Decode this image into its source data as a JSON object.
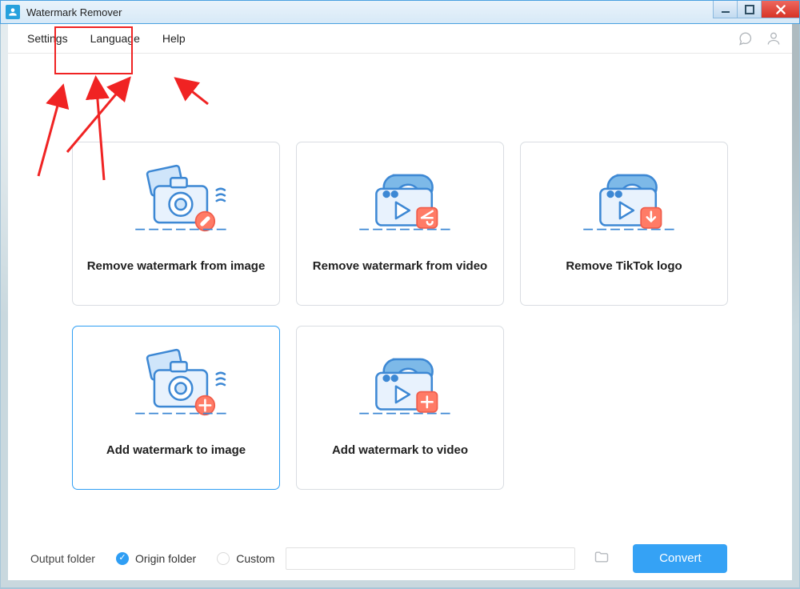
{
  "window": {
    "title": "Watermark Remover"
  },
  "menu": {
    "items": [
      "Settings",
      "Language",
      "Help"
    ]
  },
  "cards": [
    {
      "caption": "Remove watermark from image"
    },
    {
      "caption": "Remove watermark from video"
    },
    {
      "caption": "Remove TikTok logo"
    },
    {
      "caption": "Add watermark to image"
    },
    {
      "caption": "Add watermark to video"
    }
  ],
  "bottom": {
    "outputLabel": "Output folder",
    "originLabel": "Origin folder",
    "customLabel": "Custom",
    "convertLabel": "Convert"
  },
  "annotation": {
    "highlightTarget": "menu-language"
  },
  "colors": {
    "accent": "#2f9ef4",
    "danger": "#f02323"
  }
}
